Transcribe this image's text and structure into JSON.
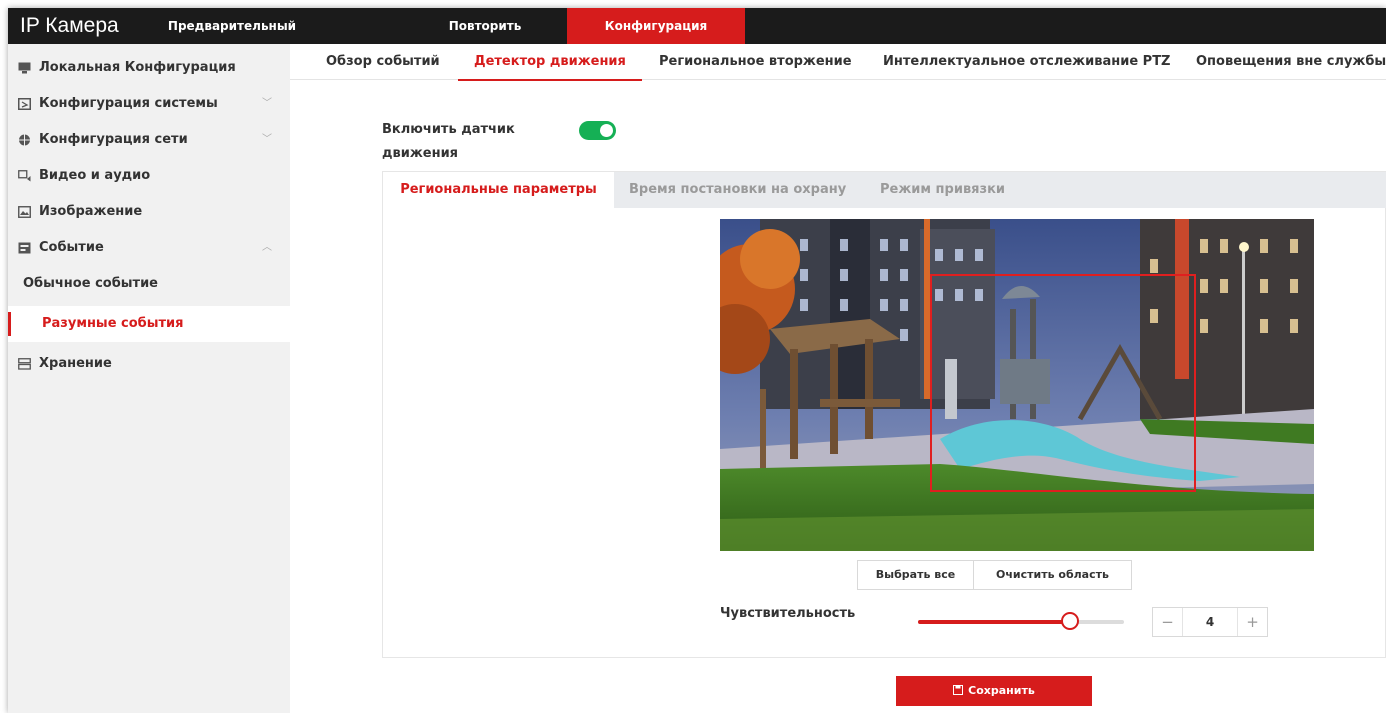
{
  "app": {
    "title": "IP Камера"
  },
  "topnav": {
    "preview": "Предварительный просмотр",
    "playback": "Повторить",
    "config": "Конфигурация"
  },
  "sidebar": {
    "items": [
      {
        "label": "Локальная Конфигурация",
        "icon": "monitor-icon"
      },
      {
        "label": "Конфигурация системы",
        "icon": "system-icon"
      },
      {
        "label": "Конфигурация сети",
        "icon": "globe-icon"
      },
      {
        "label": "Видео и аудио",
        "icon": "video-audio-icon"
      },
      {
        "label": "Изображение",
        "icon": "image-icon"
      },
      {
        "label": "Событие",
        "icon": "event-icon"
      }
    ],
    "sub_items": [
      {
        "label": "Обычное событие"
      },
      {
        "label": "Разумные события"
      }
    ],
    "storage": {
      "label": "Хранение",
      "icon": "storage-icon"
    }
  },
  "tabs": [
    {
      "label": "Обзор событий"
    },
    {
      "label": "Детектор движения"
    },
    {
      "label": "Региональное вторжение"
    },
    {
      "label": "Интеллектуальное отслеживание PTZ"
    },
    {
      "label": "Оповещения вне службы"
    }
  ],
  "motion": {
    "enable_label": "Включить датчик движения",
    "enabled": true
  },
  "subtabs": [
    {
      "label": "Региональные параметры"
    },
    {
      "label": "Время постановки на охрану"
    },
    {
      "label": "Режим привязки"
    }
  ],
  "buttons": {
    "select_all": "Выбрать все",
    "clear_area": "Очистить область",
    "save": "Сохранить"
  },
  "sensitivity": {
    "label": "Чувствительность",
    "value": "4",
    "level_percent": 74,
    "minus": "−",
    "plus": "+"
  },
  "colors": {
    "accent": "#d61c1c",
    "toggle_on": "#15b055",
    "topbar": "#1b1b1b"
  }
}
